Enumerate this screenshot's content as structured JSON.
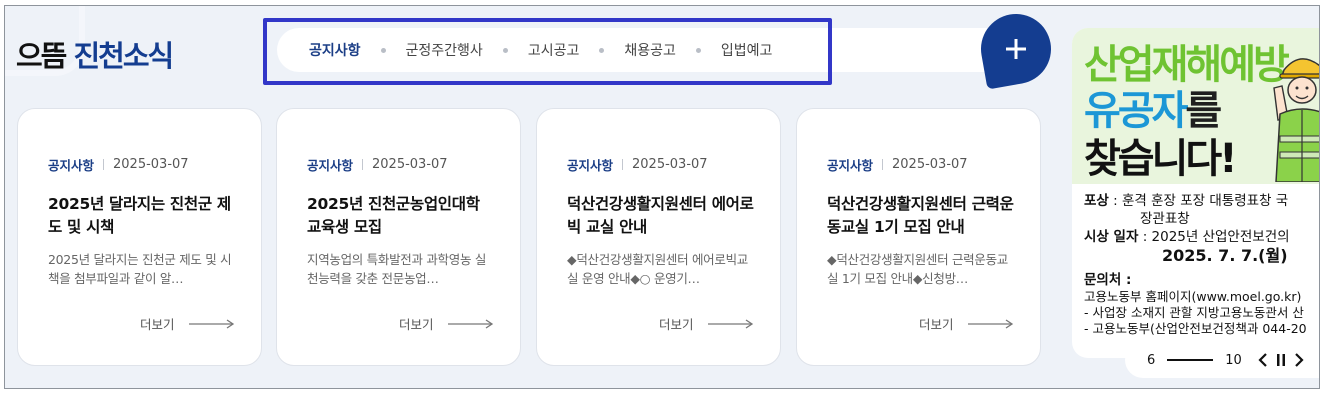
{
  "section": {
    "title_plain": "으뜸",
    "title_accent": "진천소식"
  },
  "tabs": [
    {
      "label": "공지사항",
      "active": true
    },
    {
      "label": "군정주간행사",
      "active": false
    },
    {
      "label": "고시공고",
      "active": false
    },
    {
      "label": "채용공고",
      "active": false
    },
    {
      "label": "입법예고",
      "active": false
    }
  ],
  "plus_button": {
    "icon": "plus-icon"
  },
  "cards": [
    {
      "category": "공지사항",
      "date": "2025-03-07",
      "title": "2025년 달라지는 진천군 제도 및 시책",
      "description": "2025년 달라지는 진천군 제도 및 시책을 첨부파일과 같이 알…",
      "more_label": "더보기"
    },
    {
      "category": "공지사항",
      "date": "2025-03-07",
      "title": "2025년 진천군농업인대학 교육생 모집",
      "description": "지역농업의 특화발전과 과학영농 실천능력을 갖춘 전문농업…",
      "more_label": "더보기"
    },
    {
      "category": "공지사항",
      "date": "2025-03-07",
      "title": "덕산건강생활지원센터 에어로빅 교실 안내",
      "description": "◆덕산건강생활지원센터 에어로빅교실 운영 안내◆○ 운영기…",
      "more_label": "더보기"
    },
    {
      "category": "공지사항",
      "date": "2025-03-07",
      "title": "덕산건강생활지원센터 근력운동교실 1기 모집 안내",
      "description": "◆덕산건강생활지원센터 근력운동교실 1기 모집 안내◆신청방…",
      "more_label": "더보기"
    }
  ],
  "banner": {
    "headline_1": "산업재해예방",
    "headline_2a": "유공자",
    "headline_2b": "를",
    "headline_3": "찾습니다!",
    "award_label": "포상",
    "award_text": ": 훈격 훈장 포장 대통령표창 국",
    "award_text_2": "장관표창",
    "ceremony_label": "시상 일자",
    "ceremony_text": ": 2025년 산업안전보건의",
    "ceremony_date": "2025. 7. 7.(월)",
    "contact_label": "문의처 :",
    "contact_1": "고용노동부 홈페이지(www.moel.go.kr)",
    "contact_2": "- 사업장 소재지 관할 지방고용노동관서 산",
    "contact_3": "- 고용노동부(산업안전보건정책과 044-20"
  },
  "slider": {
    "current": "6",
    "total": "10",
    "progress": 0.6,
    "prev_icon": "chevron-left-icon",
    "pause_icon": "pause-icon",
    "next_icon": "chevron-right-icon"
  },
  "colors": {
    "accent": "#143d90",
    "highlight_border": "#3237c8",
    "background": "#eef2f8"
  }
}
